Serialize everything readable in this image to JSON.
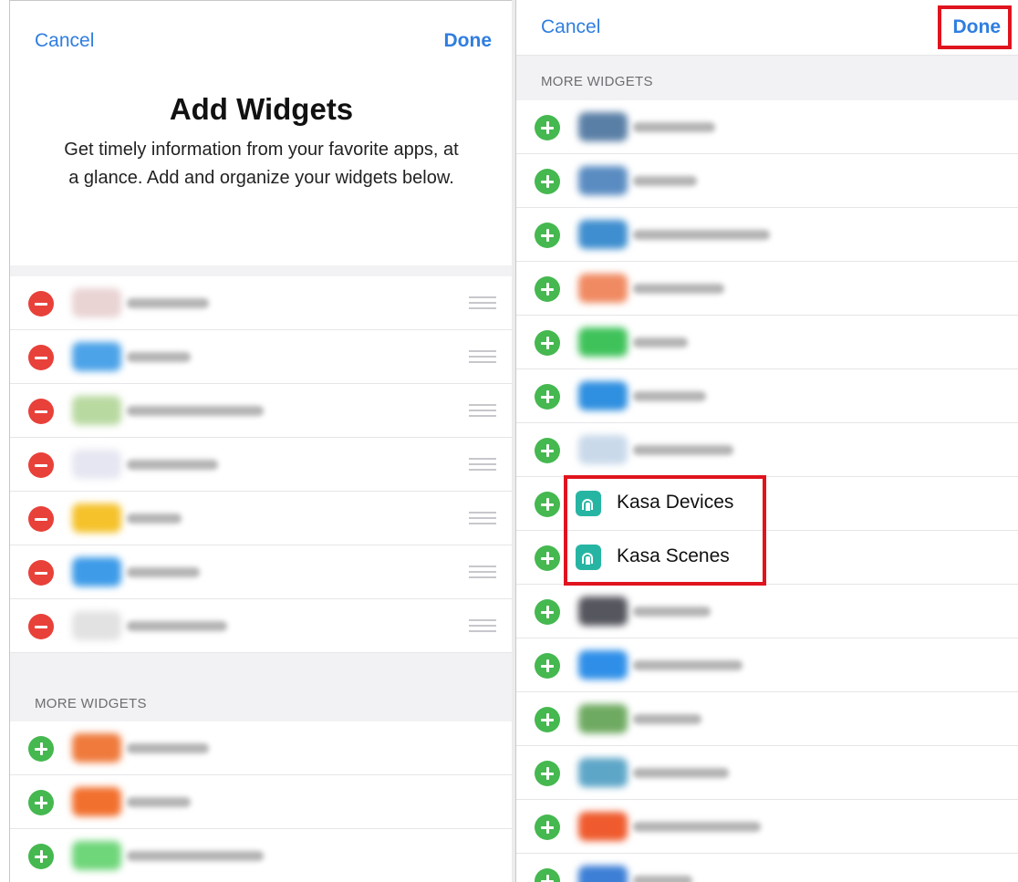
{
  "left": {
    "cancel_label": "Cancel",
    "done_label": "Done",
    "title": "Add Widgets",
    "description": "Get timely information from your favorite apps, at a glance. Add and organize your widgets below.",
    "more_widgets_label": "MORE WIDGETS",
    "active_widgets": [
      {
        "icon": "blurred-app-icon",
        "icon_color": "#e9d3d3",
        "label": ""
      },
      {
        "icon": "blurred-app-icon",
        "icon_color": "#4da3e8",
        "label": ""
      },
      {
        "icon": "blurred-app-icon",
        "icon_color": "#b8d9a0",
        "label": ""
      },
      {
        "icon": "blurred-app-icon",
        "icon_color": "#e6e6f2",
        "label": ""
      },
      {
        "icon": "blurred-app-icon",
        "icon_color": "#f5c22c",
        "label": ""
      },
      {
        "icon": "blurred-app-icon",
        "icon_color": "#3d9be8",
        "label": ""
      },
      {
        "icon": "blurred-app-icon",
        "icon_color": "#e2e2e2",
        "label": ""
      }
    ],
    "more_widgets": [
      {
        "icon": "blurred-app-icon",
        "icon_color": "#ef7a3c",
        "label": ""
      },
      {
        "icon": "blurred-app-icon",
        "icon_color": "#f2702e",
        "label": ""
      },
      {
        "icon": "blurred-app-icon",
        "icon_color": "#6fd67a",
        "label": ""
      }
    ]
  },
  "right": {
    "cancel_label": "Cancel",
    "done_label": "Done",
    "more_widgets_label": "MORE WIDGETS",
    "widgets": [
      {
        "icon": "blurred-app-icon",
        "icon_color": "#5a7fa6",
        "label": ""
      },
      {
        "icon": "blurred-app-icon",
        "icon_color": "#5a8cc2",
        "label": ""
      },
      {
        "icon": "blurred-app-icon",
        "icon_color": "#3f8ecf",
        "label": ""
      },
      {
        "icon": "blurred-app-icon",
        "icon_color": "#f08a62",
        "label": ""
      },
      {
        "icon": "blurred-app-icon",
        "icon_color": "#3fc25a",
        "label": ""
      },
      {
        "icon": "blurred-app-icon",
        "icon_color": "#2f8fe0",
        "label": ""
      },
      {
        "icon": "blurred-app-icon",
        "icon_color": "#c9d9ea",
        "label": ""
      },
      {
        "icon": "kasa-icon",
        "icon_color": "#27b5a3",
        "label": "Kasa Devices",
        "highlighted": true
      },
      {
        "icon": "kasa-icon",
        "icon_color": "#27b5a3",
        "label": "Kasa Scenes",
        "highlighted": true
      },
      {
        "icon": "blurred-app-icon",
        "icon_color": "#55565e",
        "label": ""
      },
      {
        "icon": "blurred-app-icon",
        "icon_color": "#2f8fe8",
        "label": ""
      },
      {
        "icon": "blurred-app-icon",
        "icon_color": "#6faa62",
        "label": ""
      },
      {
        "icon": "blurred-app-icon",
        "icon_color": "#5ea6c8",
        "label": ""
      },
      {
        "icon": "blurred-app-icon",
        "icon_color": "#ef5b2e",
        "label": ""
      },
      {
        "icon": "blurred-app-icon",
        "icon_color": "#3d7fd6",
        "label": ""
      }
    ]
  },
  "colors": {
    "accent_blue": "#2f7ee0",
    "remove_red": "#e8413a",
    "add_green": "#45b84f",
    "highlight_red": "#e0141e",
    "kasa_teal": "#27b5a3"
  }
}
